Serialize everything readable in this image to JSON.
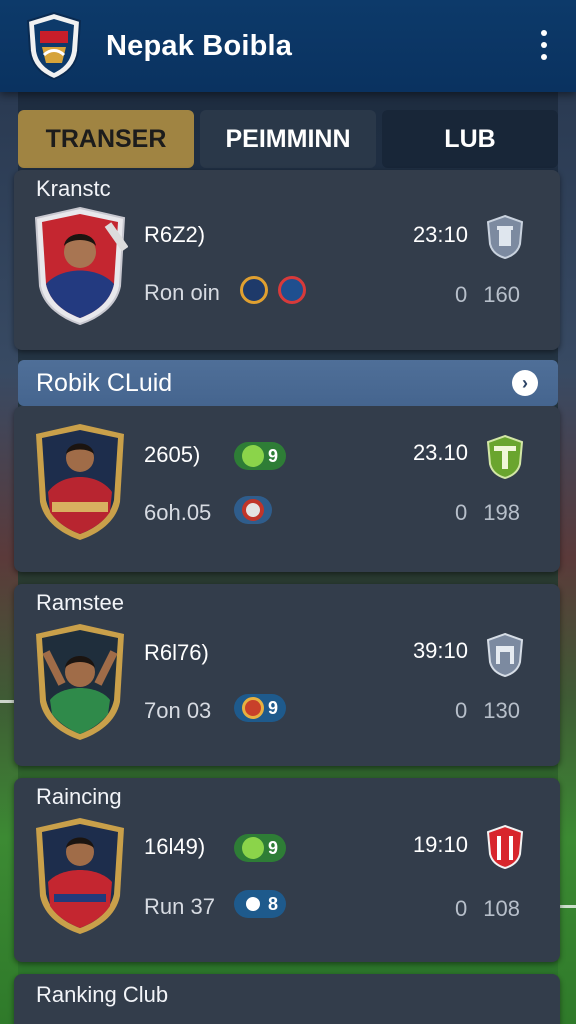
{
  "app": {
    "title": "Nepak Boibla"
  },
  "tabs": [
    {
      "label": "TRANSER"
    },
    {
      "label": "PEIMMINN"
    },
    {
      "label": "LUB"
    }
  ],
  "colors": {
    "header": "#0a3260",
    "tab_active": "#a08442",
    "card": "#333d4b",
    "section_bar": "#4f6f98",
    "pill_green": "#3aa33a",
    "pill_blue": "#1e5a8c"
  },
  "cards": [
    {
      "header": "Kranstc",
      "rating": "R6Z2)",
      "sub": "Ron oin",
      "time": "23:10",
      "stat": "0 160",
      "club_icon": "grey-tower-crest-icon"
    },
    {
      "rating": "2605)",
      "pill_value": "9",
      "sub": "6oh.05",
      "time": "23.10",
      "stat": "0 198",
      "club_icon": "green-shield-crest-icon"
    },
    {
      "header": "Ramstee",
      "rating": "R6l76)",
      "sub": "7on 03",
      "pill_value": "9",
      "time": "39:10",
      "stat": "0 130",
      "club_icon": "grey-castle-crest-icon"
    },
    {
      "header": "Raincing",
      "rating": "16l49)",
      "pill_value": "9",
      "sub": "Run 37",
      "pill_value2": "8",
      "time": "19:10",
      "stat": "0 108",
      "club_icon": "red-striped-crest-icon"
    }
  ],
  "section": {
    "title": "Robik CLuid"
  },
  "footer_card": {
    "header": "Ranking Club"
  }
}
